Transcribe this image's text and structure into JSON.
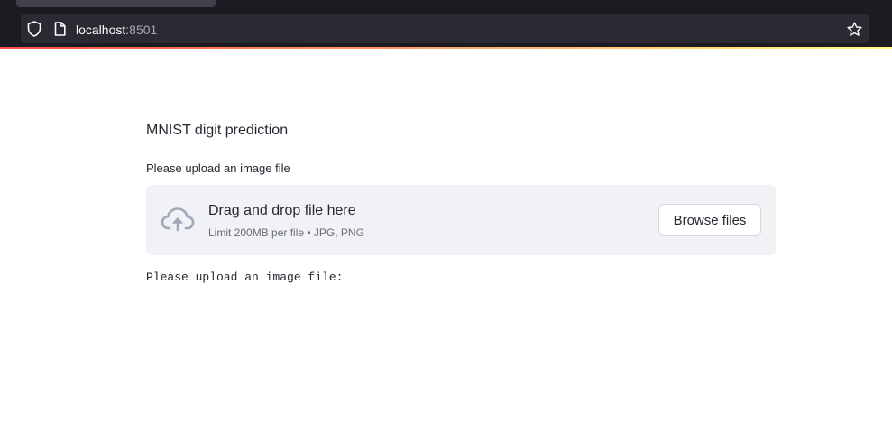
{
  "browser": {
    "url_host": "localhost",
    "url_port": ":8501",
    "icons": {
      "tracking": "shield-icon",
      "page": "page-icon",
      "bookmark": "star-icon"
    }
  },
  "app": {
    "title": "MNIST digit prediction",
    "accent_gradient": [
      "#ff4b4b",
      "#fffd80"
    ]
  },
  "uploader": {
    "label": "Please upload an image file",
    "drop_instructions": "Drag and drop file here",
    "limits": "Limit 200MB per file • JPG, PNG",
    "browse_label": "Browse files",
    "icon": "cloud-upload-icon"
  },
  "status": {
    "message": "Please upload an image file:"
  },
  "colors": {
    "chrome_bg": "#1c1b22",
    "url_bar_bg": "#2b2a33",
    "dropzone_bg": "#f0f2f6",
    "text": "#262730",
    "muted_text": "#6b6d76",
    "icon": "#a3a8b8"
  }
}
